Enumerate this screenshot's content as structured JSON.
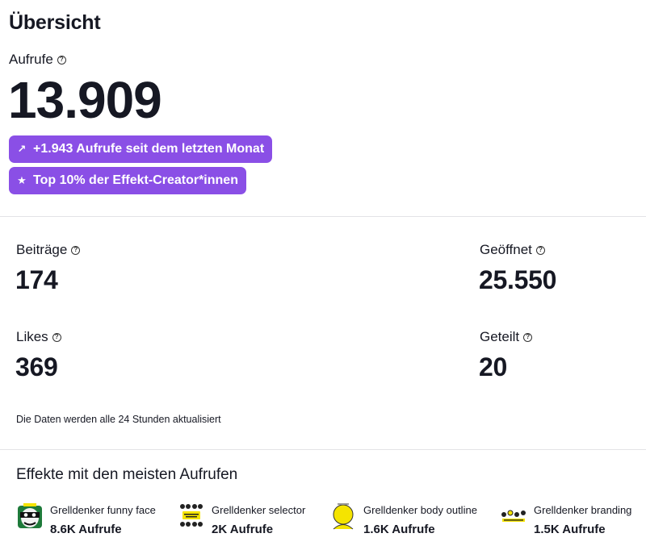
{
  "overview": {
    "title": "Übersicht",
    "views_label": "Aufrufe",
    "views_value": "13.909",
    "badges": [
      {
        "icon": "arrow-up-right-icon",
        "glyph": "↗",
        "text": "+1.943 Aufrufe seit dem letzten Monat"
      },
      {
        "icon": "star-icon",
        "glyph": "★",
        "text": "Top 10% der Effekt-Creator*innen"
      }
    ],
    "accent_color": "#8a4fe6"
  },
  "stats": [
    {
      "label": "Beiträge",
      "value": "174"
    },
    {
      "label": "Geöffnet",
      "value": "25.550"
    },
    {
      "label": "Likes",
      "value": "369"
    },
    {
      "label": "Geteilt",
      "value": "20"
    }
  ],
  "update_note": "Die Daten werden alle 24 Stunden aktualisiert",
  "top_effects": {
    "title": "Effekte mit den meisten Aufrufen",
    "items": [
      {
        "name": "Grelldenker funny face",
        "views": "8.6K Aufrufe",
        "thumb": "funny-face-thumbnail"
      },
      {
        "name": "Grelldenker selector",
        "views": "2K Aufrufe",
        "thumb": "selector-thumbnail"
      },
      {
        "name": "Grelldenker body outline",
        "views": "1.6K Aufrufe",
        "thumb": "body-outline-thumbnail"
      },
      {
        "name": "Grelldenker branding",
        "views": "1.5K Aufrufe",
        "thumb": "branding-thumbnail"
      }
    ]
  }
}
